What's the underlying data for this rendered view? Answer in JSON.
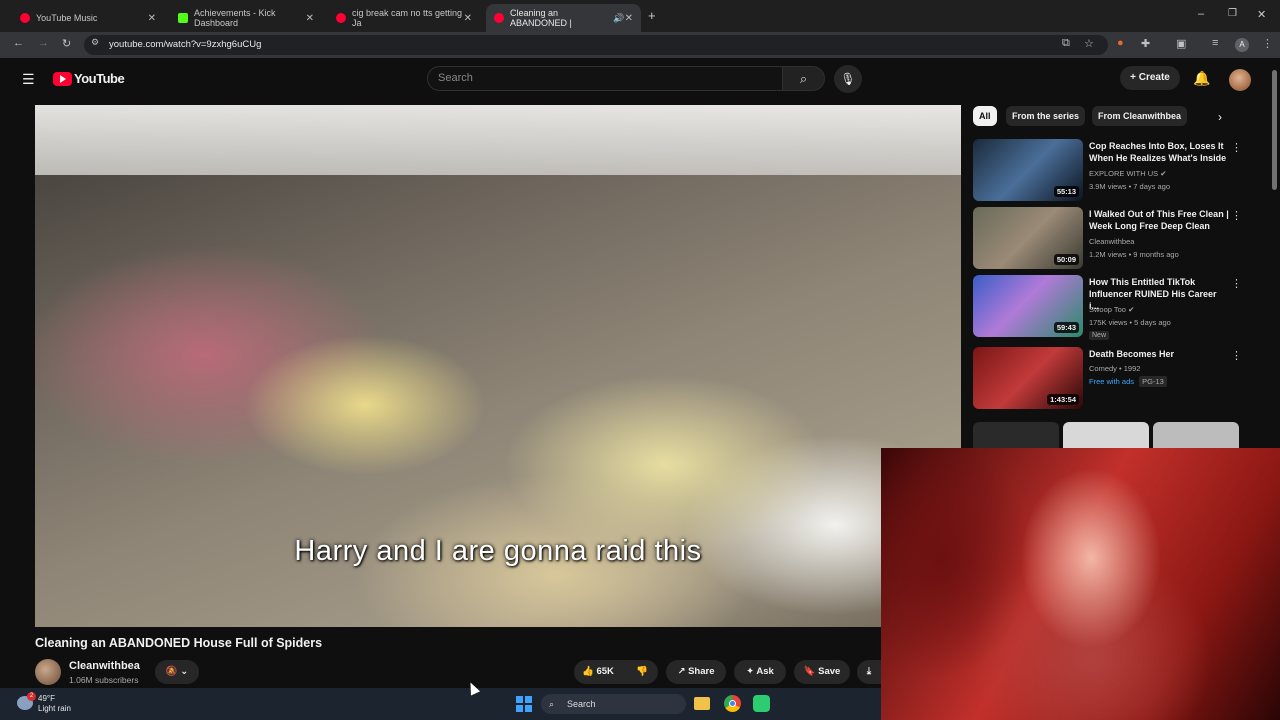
{
  "browser": {
    "tabs": [
      {
        "label": "YouTube Music",
        "color": "#ff0033"
      },
      {
        "label": "Achievements - Kick Dashboard",
        "color": "#53fc18"
      },
      {
        "label": "cig break cam no tts getting Ja",
        "color": "#ff0033"
      },
      {
        "label": "Cleaning an ABANDONED |",
        "color": "#ff0033"
      }
    ],
    "url": "youtube.com/watch?v=9zxhg6uCUg"
  },
  "header": {
    "logo_text": "YouTube",
    "search_placeholder": "Search",
    "create_label": "Create"
  },
  "video": {
    "caption": "Harry and I are gonna raid this",
    "title": "Cleaning an ABANDONED House Full of Spiders",
    "channel": "Cleanwithbea",
    "subscribers": "1.06M subscribers",
    "like_count": "65K",
    "share_label": "Share",
    "ask_label": "Ask",
    "save_label": "Save"
  },
  "sidebar": {
    "chips": [
      "All",
      "From the series",
      "From Cleanwithbea"
    ],
    "videos": [
      {
        "title": "Cop Reaches Into Box, Loses It When He Realizes What's Inside",
        "channel": "EXPLORE WITH US",
        "meta": "3.9M views • 7 days ago",
        "duration": "55:13",
        "badge": ""
      },
      {
        "title": "I Walked Out of This Free Clean | Week Long Free Deep Clean",
        "channel": "Cleanwithbea",
        "meta": "1.2M views • 9 months ago",
        "duration": "50:09",
        "badge": ""
      },
      {
        "title": "How This Entitled TikTok Influencer RUINED His Career i...",
        "channel": "Swoop Too",
        "meta": "175K views • 5 days ago",
        "duration": "59:43",
        "badge": "New"
      },
      {
        "title": "Death Becomes Her",
        "channel": "Comedy • 1992",
        "meta": "Free with ads",
        "duration": "1:43:54",
        "badge": "PG-13"
      }
    ]
  },
  "taskbar": {
    "temperature": "49°F",
    "condition": "Light rain",
    "search_label": "Search",
    "notification_count": "2"
  }
}
